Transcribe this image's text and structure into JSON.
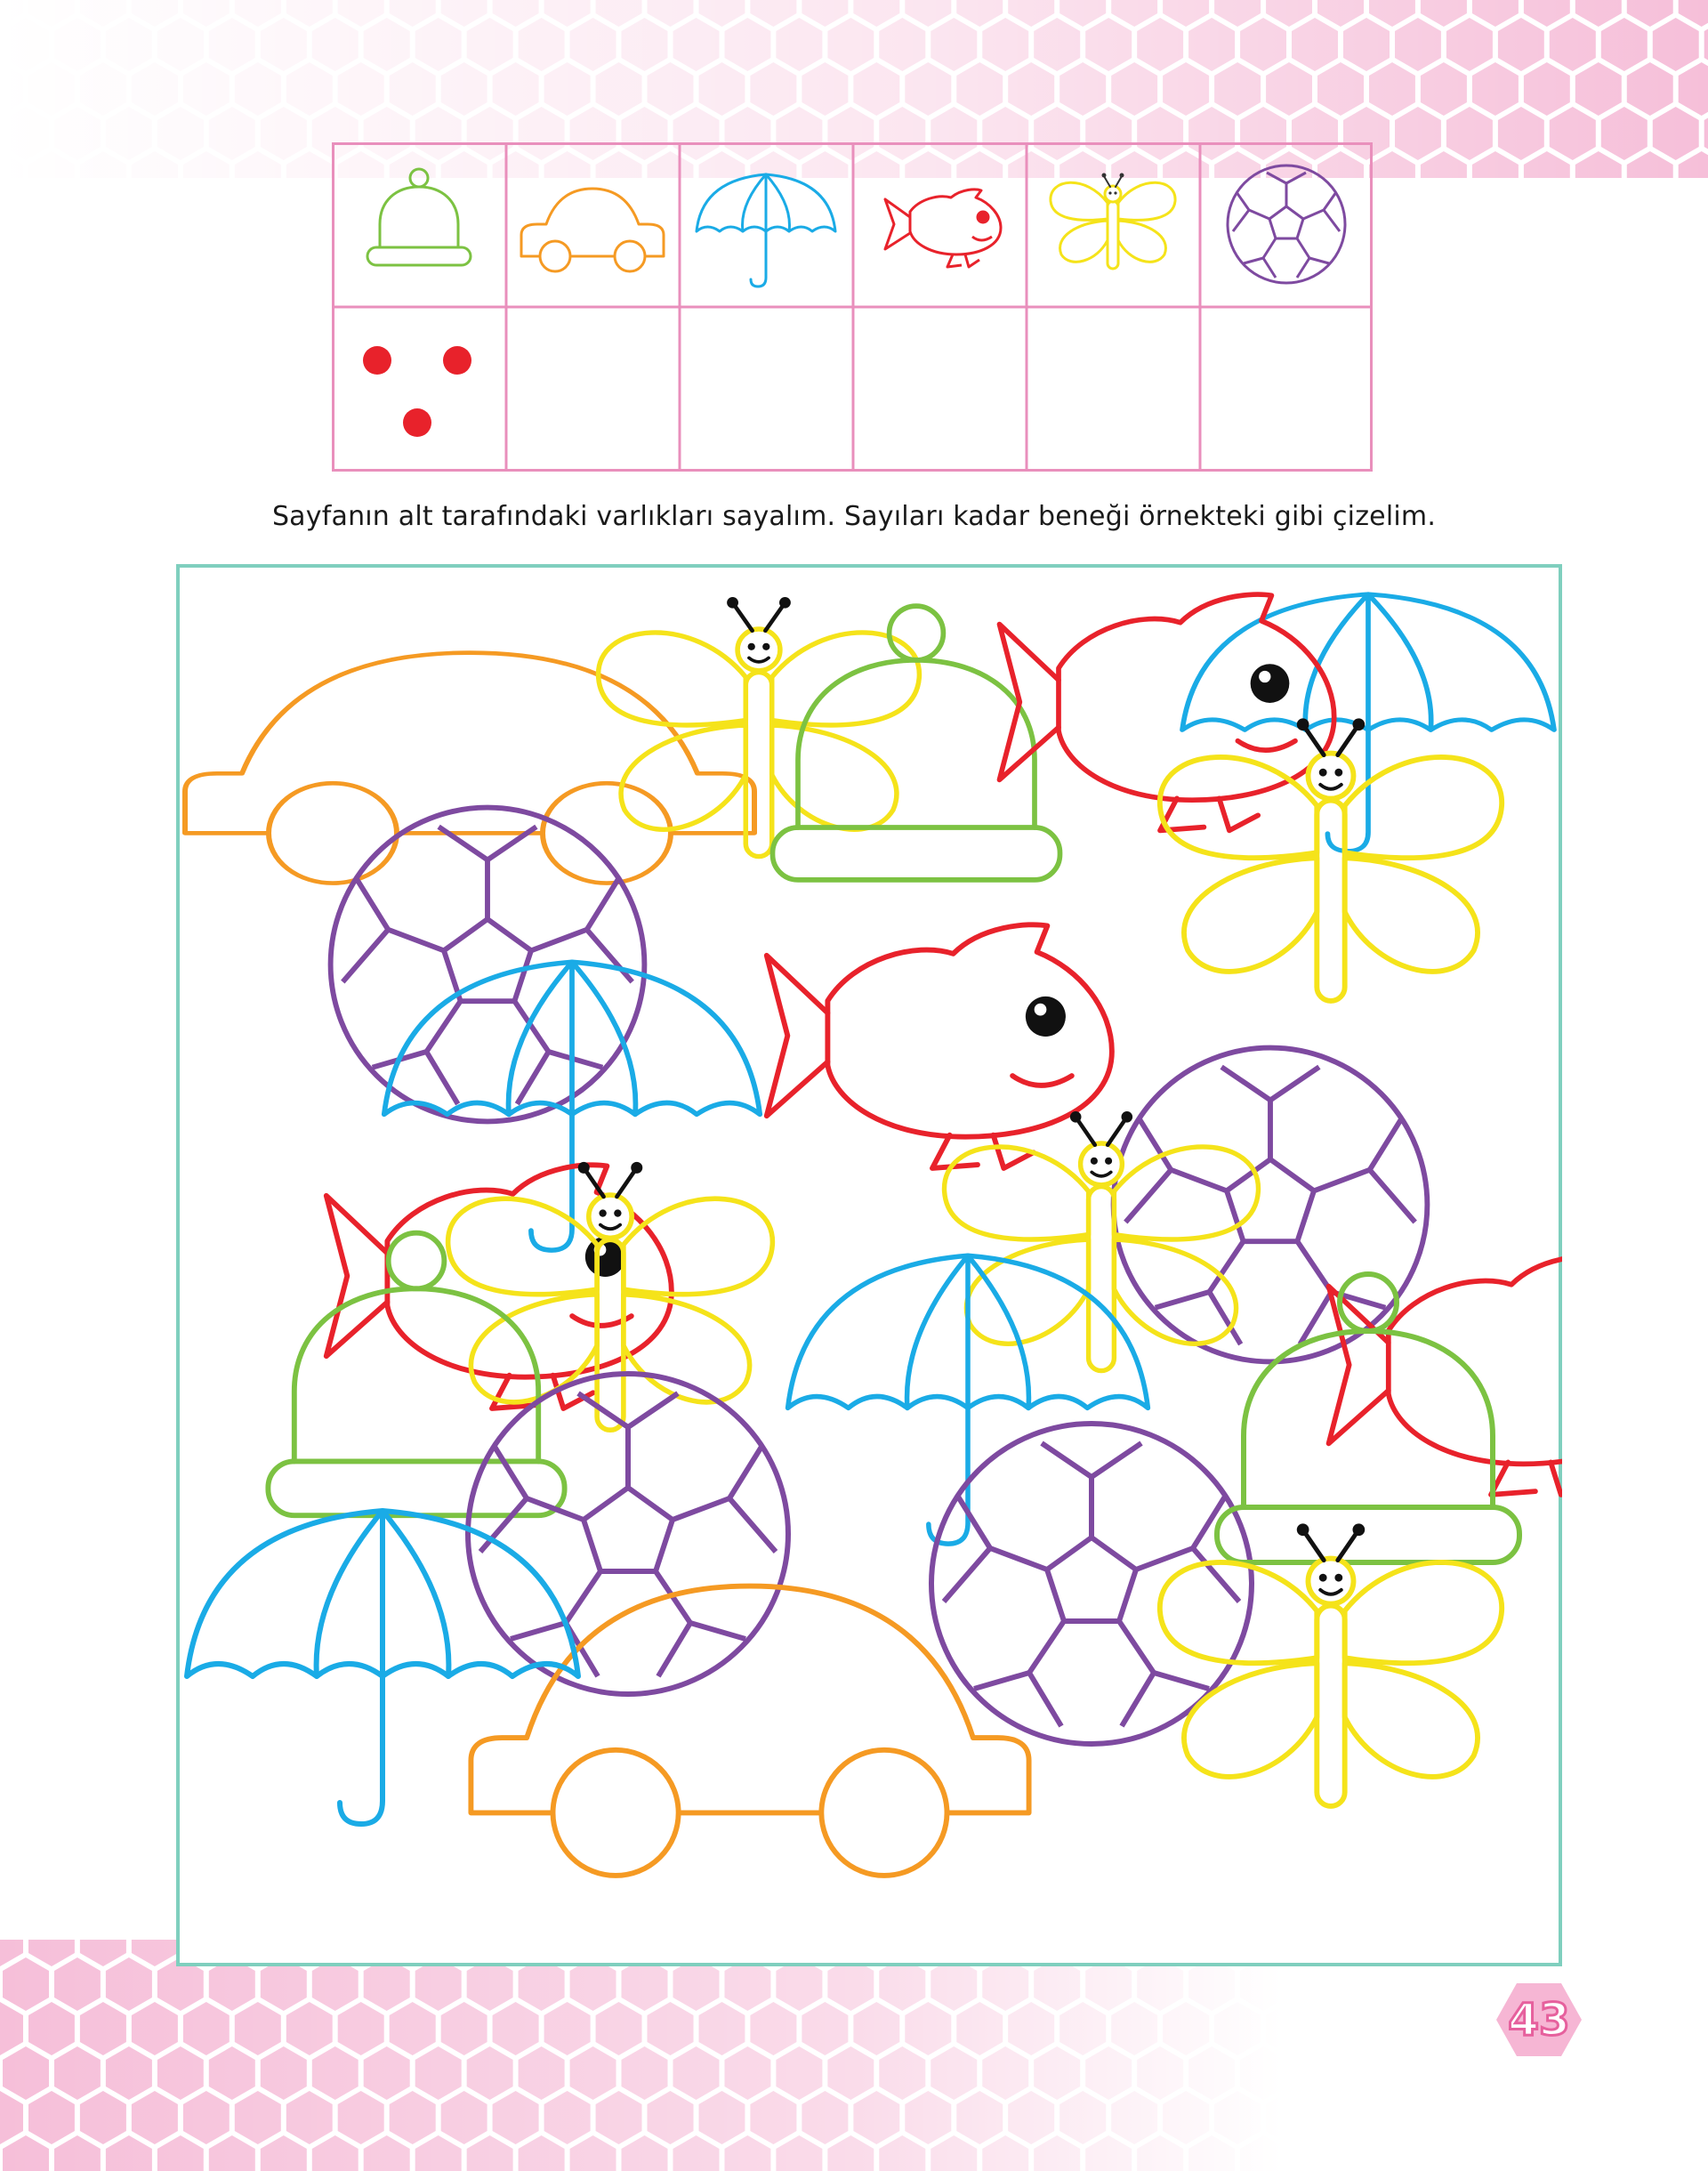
{
  "instruction": "Sayfanın alt tarafındaki varlıkları sayalım. Sayıları kadar beneği örnekteki gibi çizelim.",
  "page_number": "43",
  "table": {
    "columns": [
      {
        "icon": "beanie-hat-icon",
        "color": "#7cc242",
        "example_dots": 3
      },
      {
        "icon": "car-icon",
        "color": "#f59a23",
        "example_dots": 0
      },
      {
        "icon": "umbrella-icon",
        "color": "#1aabe6",
        "example_dots": 0
      },
      {
        "icon": "fish-icon",
        "color": "#e8222b",
        "example_dots": 0
      },
      {
        "icon": "butterfly-icon",
        "color": "#f5e31a",
        "example_dots": 0
      },
      {
        "icon": "soccer-ball-icon",
        "color": "#7e4aa0",
        "example_dots": 0
      }
    ]
  },
  "colors": {
    "grid_border": "#e98fbc",
    "frame_border": "#7fcfbe",
    "dot": "#e8222b",
    "hexagon": "#f6bfd9",
    "page_number_badge": "#f6b6d4"
  }
}
